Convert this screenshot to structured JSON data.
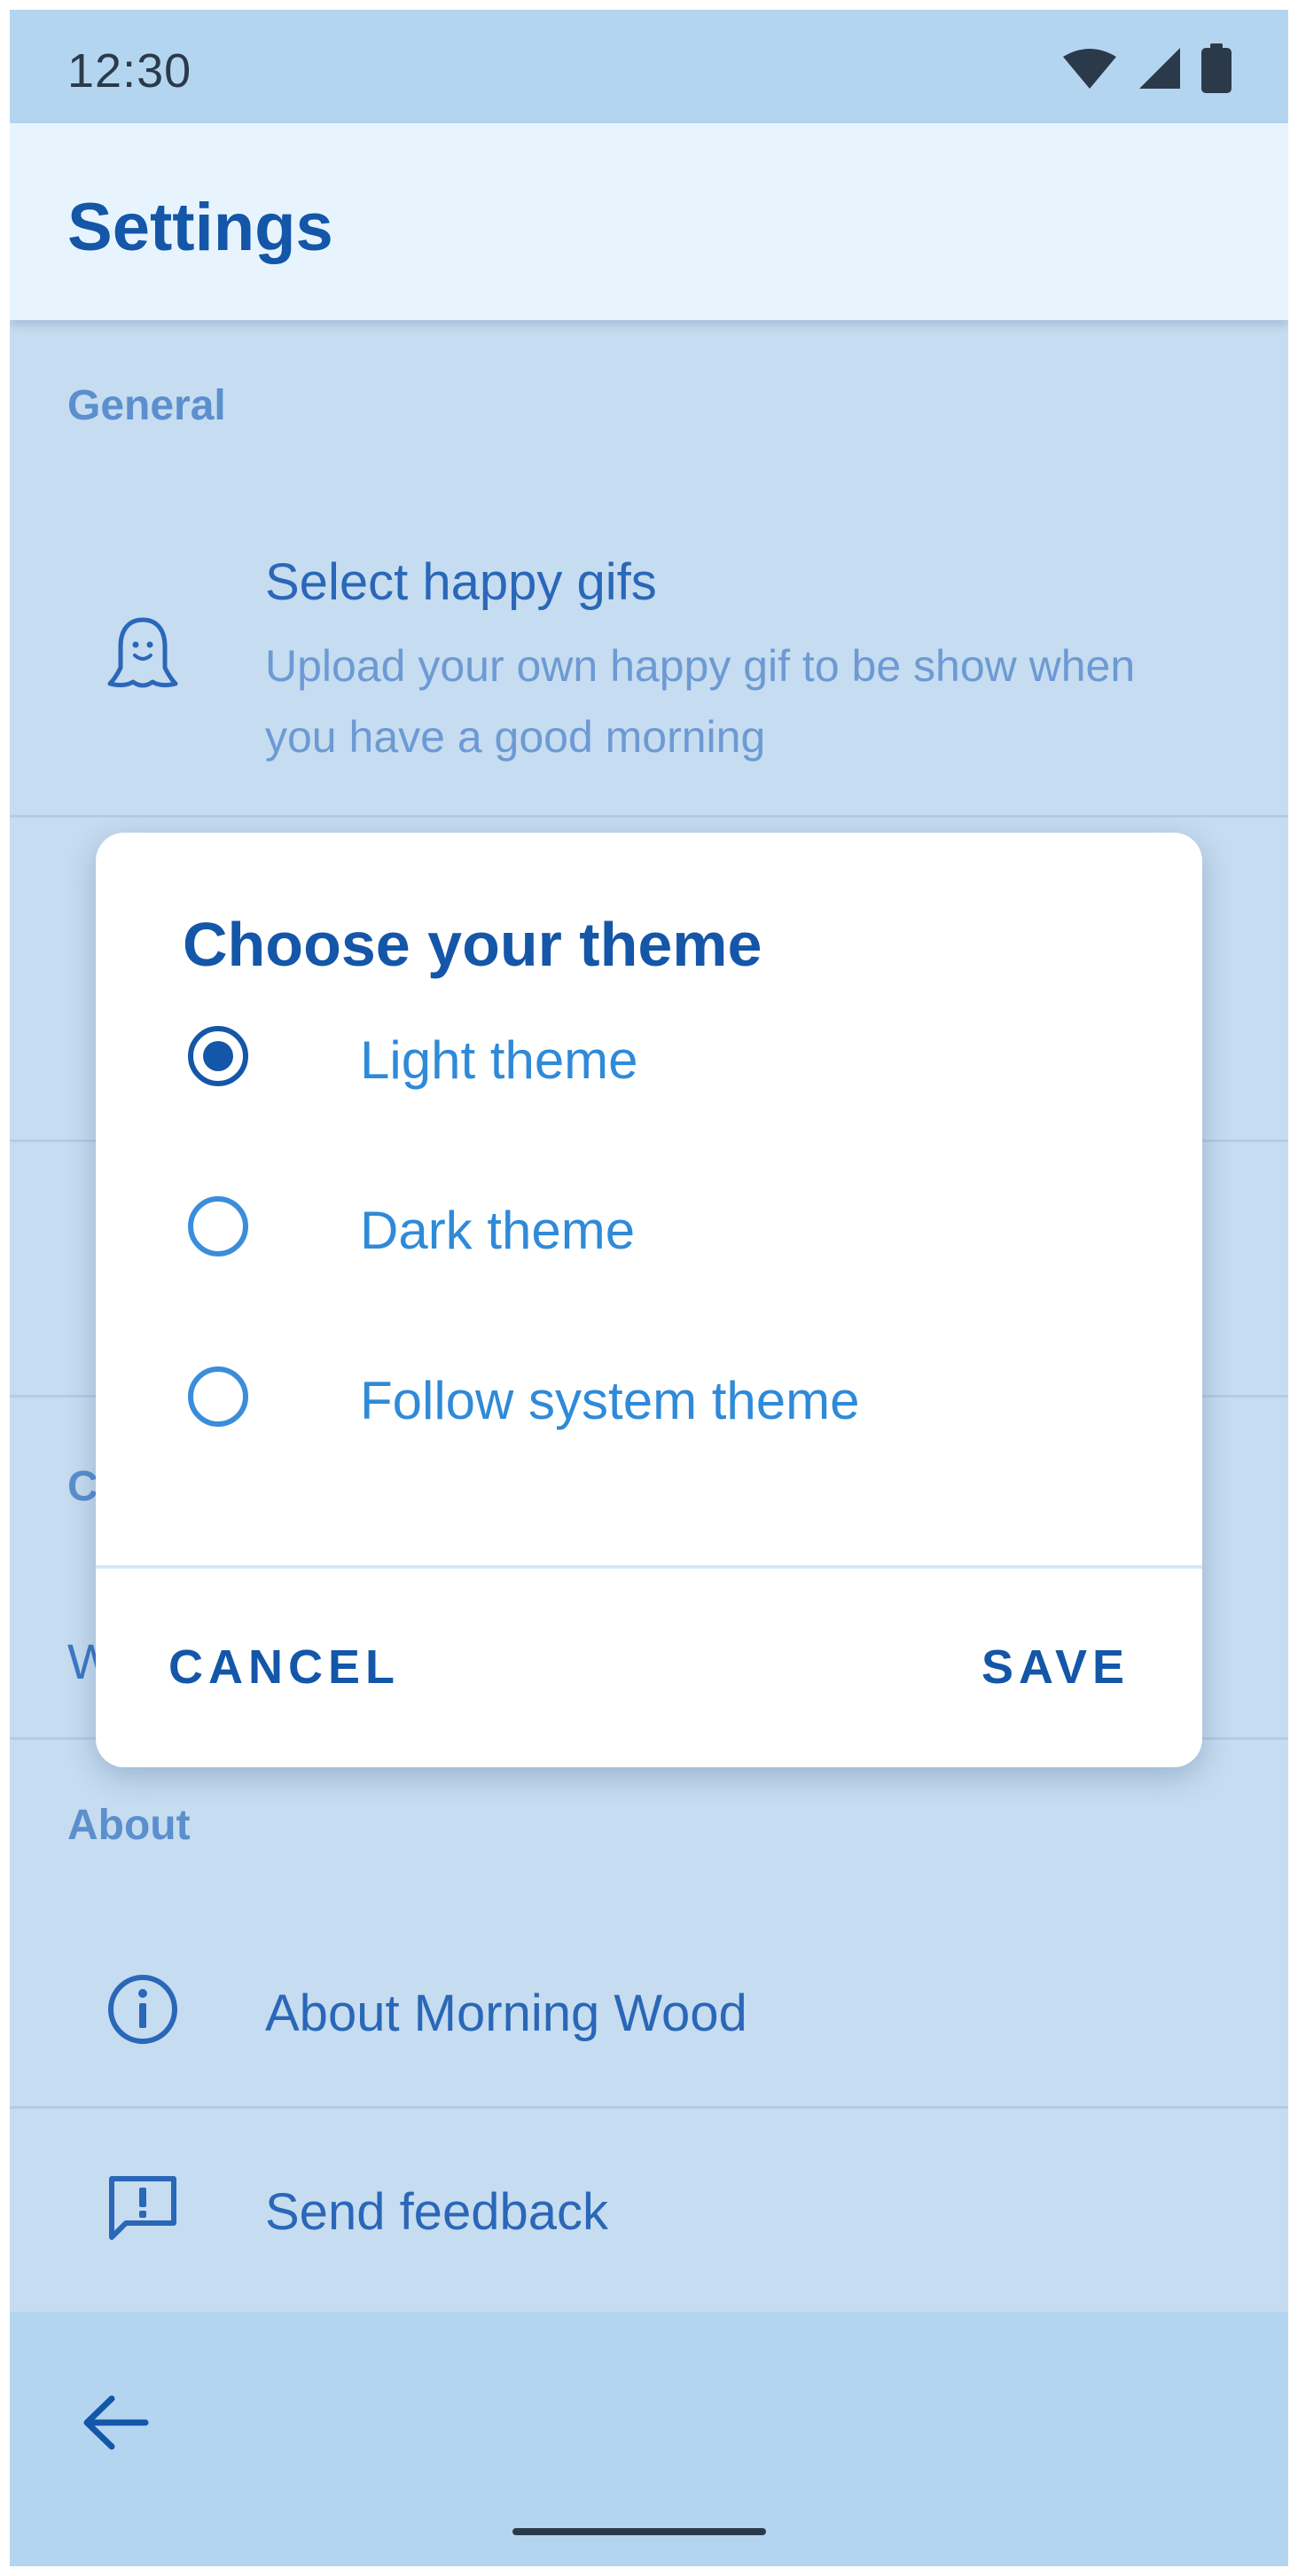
{
  "status_bar": {
    "time": "12:30",
    "icons": [
      "wifi-icon",
      "signal-icon",
      "battery-icon"
    ]
  },
  "app_bar": {
    "title": "Settings"
  },
  "sections": {
    "general": {
      "label": "General",
      "items": [
        {
          "icon": "ghost-icon",
          "title": "Select happy gifs",
          "subtitle": "Upload your own happy gif to be show when you have a good morning"
        }
      ]
    },
    "partially_hidden": {
      "label_fragment": "C",
      "item_fragment": "W"
    },
    "about": {
      "label": "About",
      "items": [
        {
          "icon": "info-icon",
          "title": "About Morning Wood"
        },
        {
          "icon": "feedback-icon",
          "title": "Send feedback"
        }
      ]
    }
  },
  "dialog": {
    "title": "Choose your theme",
    "options": [
      {
        "label": "Light theme",
        "selected": true
      },
      {
        "label": "Dark theme",
        "selected": false
      },
      {
        "label": "Follow system theme",
        "selected": false
      }
    ],
    "cancel_label": "CANCEL",
    "save_label": "SAVE"
  },
  "bottom_bar": {
    "back_icon": "arrow-back-icon"
  },
  "colors": {
    "primary": "#1456a8",
    "accent": "#2f8ad8",
    "scrim_background": "#c6dcf0",
    "status_bar": "#b4d5f0",
    "app_bar": "#e8f4fd"
  }
}
